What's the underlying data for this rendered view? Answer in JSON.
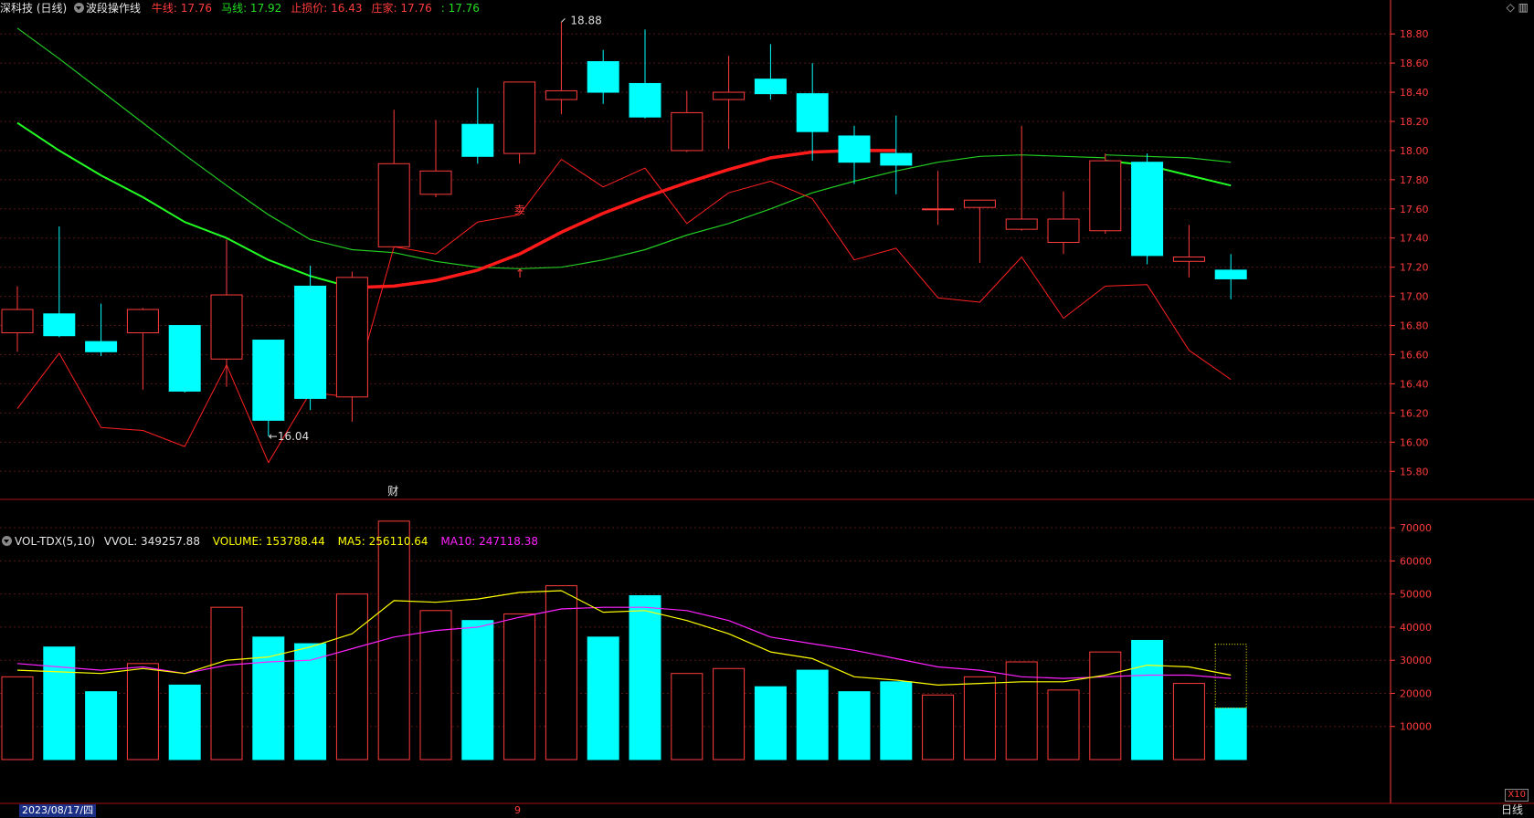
{
  "header": {
    "stock_title": "深科技 (日线)",
    "indicator_name": "波段操作线",
    "items": [
      {
        "label": "牛线:",
        "value": "17.76",
        "color": "#ff3c3c"
      },
      {
        "label": "马线:",
        "value": "17.92",
        "color": "#22dd22"
      },
      {
        "label": "止损价:",
        "value": "16.43",
        "color": "#ff3c3c"
      },
      {
        "label": "庄家:",
        "value": "17.76",
        "color": "#ff3c3c"
      },
      {
        "label": ":",
        "value": "17.76",
        "color": "#22dd22"
      }
    ],
    "corner_icons": [
      "diamond-icon",
      "book-icon"
    ]
  },
  "price_panel": {
    "axis_ticks": [
      "18.80",
      "18.60",
      "18.40",
      "18.20",
      "18.00",
      "17.80",
      "17.60",
      "17.40",
      "17.20",
      "17.00",
      "16.80",
      "16.60",
      "16.40",
      "16.20",
      "16.00",
      "15.80"
    ],
    "high_annotation": "18.88",
    "low_annotation": "16.04",
    "sell_marker": "卖",
    "buy_marker": "↑",
    "finance_marker": "财"
  },
  "volume_header": {
    "name": "VOL-TDX(5,10)",
    "vvol_label": "VVOL: 349257.88",
    "volume_label": "VOLUME: 153788.44",
    "ma5_label": "MA5: 256110.64",
    "ma10_label": "MA10: 247118.38"
  },
  "volume_panel": {
    "axis_ticks": [
      "70000",
      "60000",
      "50000",
      "40000",
      "30000",
      "20000",
      "10000"
    ],
    "scale_badge": "X10"
  },
  "footer": {
    "date": "2023/08/17/四",
    "month_mark": "9",
    "period": "日线"
  },
  "colors": {
    "up": "#ff3c3c",
    "down": "#00ffff",
    "bull_line": "#ff1a1a",
    "fast_green": "#22ff22",
    "slow_green": "#22cc22",
    "stop_line": "#ff2020",
    "ma5": "#ffff00",
    "ma10": "#ff22ff",
    "grid": "#551515",
    "axis_text": "#ff3c3c"
  },
  "chart_data": {
    "type": "candlestick",
    "candles": [
      {
        "o": 16.75,
        "h": 17.07,
        "l": 16.62,
        "c": 16.91
      },
      {
        "o": 16.88,
        "h": 17.48,
        "l": 16.72,
        "c": 16.73
      },
      {
        "o": 16.69,
        "h": 16.95,
        "l": 16.59,
        "c": 16.62
      },
      {
        "o": 16.75,
        "h": 16.92,
        "l": 16.36,
        "c": 16.91
      },
      {
        "o": 16.8,
        "h": 16.8,
        "l": 16.34,
        "c": 16.35
      },
      {
        "o": 16.57,
        "h": 17.39,
        "l": 16.38,
        "c": 17.01
      },
      {
        "o": 16.7,
        "h": 16.7,
        "l": 16.04,
        "c": 16.15
      },
      {
        "o": 17.07,
        "h": 17.21,
        "l": 16.22,
        "c": 16.3
      },
      {
        "o": 16.31,
        "h": 17.17,
        "l": 16.14,
        "c": 17.13
      },
      {
        "o": 17.34,
        "h": 18.28,
        "l": 17.34,
        "c": 17.91
      },
      {
        "o": 17.7,
        "h": 18.21,
        "l": 17.68,
        "c": 17.86
      },
      {
        "o": 18.18,
        "h": 18.43,
        "l": 17.91,
        "c": 17.96
      },
      {
        "o": 17.98,
        "h": 18.47,
        "l": 17.91,
        "c": 18.47
      },
      {
        "o": 18.35,
        "h": 18.88,
        "l": 18.25,
        "c": 18.41
      },
      {
        "o": 18.61,
        "h": 18.69,
        "l": 18.32,
        "c": 18.4
      },
      {
        "o": 18.46,
        "h": 18.83,
        "l": 18.22,
        "c": 18.23
      },
      {
        "o": 18.0,
        "h": 18.41,
        "l": 17.99,
        "c": 18.26
      },
      {
        "o": 18.35,
        "h": 18.65,
        "l": 18.01,
        "c": 18.4
      },
      {
        "o": 18.49,
        "h": 18.73,
        "l": 18.35,
        "c": 18.39
      },
      {
        "o": 18.39,
        "h": 18.6,
        "l": 17.93,
        "c": 18.13
      },
      {
        "o": 18.1,
        "h": 18.17,
        "l": 17.77,
        "c": 17.92
      },
      {
        "o": 17.98,
        "h": 18.24,
        "l": 17.7,
        "c": 17.9
      },
      {
        "o": 17.6,
        "h": 17.86,
        "l": 17.49,
        "c": 17.6
      },
      {
        "o": 17.61,
        "h": 17.66,
        "l": 17.23,
        "c": 17.66
      },
      {
        "o": 17.46,
        "h": 18.17,
        "l": 17.45,
        "c": 17.53
      },
      {
        "o": 17.37,
        "h": 17.72,
        "l": 17.29,
        "c": 17.53
      },
      {
        "o": 17.45,
        "h": 17.98,
        "l": 17.43,
        "c": 17.93
      },
      {
        "o": 17.92,
        "h": 17.98,
        "l": 17.22,
        "c": 17.28
      },
      {
        "o": 17.24,
        "h": 17.49,
        "l": 17.13,
        "c": 17.27
      },
      {
        "o": 17.18,
        "h": 17.29,
        "l": 16.98,
        "c": 17.12
      }
    ],
    "bull_line": [
      null,
      null,
      null,
      null,
      null,
      null,
      null,
      null,
      17.06,
      17.07,
      17.11,
      17.18,
      17.29,
      17.44,
      17.57,
      17.68,
      17.78,
      17.87,
      17.95,
      17.99,
      18.0,
      18.0
    ],
    "fast_green": [
      18.19,
      18.0,
      17.83,
      17.68,
      17.51,
      17.4,
      17.25,
      17.14,
      17.06
    ],
    "slow_green": [
      18.84,
      18.63,
      18.41,
      18.19,
      17.97,
      17.76,
      17.56,
      17.39,
      17.32,
      17.3,
      17.24,
      17.2,
      17.19,
      17.2,
      17.25,
      17.32,
      17.42,
      17.5,
      17.6,
      17.71,
      17.79,
      17.86,
      17.92,
      17.96,
      17.97,
      17.96,
      17.95
    ],
    "stop_line": [
      16.23,
      16.61,
      16.1,
      16.08,
      15.97,
      16.53,
      15.86,
      16.34,
      16.31,
      17.34,
      17.29,
      17.51,
      17.56,
      17.94,
      17.75,
      17.88,
      17.5,
      17.71,
      17.79,
      17.67,
      17.25,
      17.33,
      16.99,
      16.96,
      17.27,
      16.85,
      17.07,
      17.08,
      16.63,
      16.43
    ],
    "fast_green_tail": [
      null,
      null,
      null,
      null,
      null,
      null,
      null,
      null,
      null,
      null,
      null,
      null,
      null,
      null,
      null,
      null,
      null,
      null,
      null,
      null,
      null,
      null,
      null,
      null,
      null,
      null,
      17.93,
      17.9,
      17.83,
      17.76
    ],
    "slow_green_tail": [
      null,
      null,
      null,
      null,
      null,
      null,
      null,
      null,
      null,
      null,
      null,
      null,
      null,
      null,
      null,
      null,
      null,
      null,
      null,
      null,
      null,
      null,
      null,
      null,
      null,
      null,
      17.97,
      17.96,
      17.95,
      17.92
    ],
    "volume": [
      25000,
      34000,
      20500,
      29000,
      22500,
      46000,
      37000,
      35000,
      50000,
      72000,
      45000,
      42000,
      44000,
      52500,
      37000,
      49500,
      26000,
      27500,
      22000,
      27000,
      20500,
      23500,
      19500,
      25000,
      29500,
      21000,
      32500,
      36000,
      23000,
      15500
    ],
    "ma5": [
      27000,
      26500,
      26000,
      27500,
      26000,
      30000,
      31000,
      34000,
      38000,
      48000,
      47500,
      48500,
      50500,
      51000,
      44500,
      45000,
      42000,
      38000,
      32500,
      30500,
      25000,
      24000,
      22500,
      23000,
      23500,
      23500,
      25500,
      28500,
      28000,
      25500
    ],
    "ma10": [
      29000,
      28000,
      27000,
      28000,
      26000,
      28500,
      29500,
      30000,
      33500,
      37000,
      39000,
      40000,
      43000,
      45500,
      46000,
      46000,
      45000,
      42000,
      37000,
      35000,
      33000,
      30500,
      28000,
      27000,
      25000,
      24500,
      25000,
      25500,
      25500,
      24500
    ],
    "vol_ylim": [
      0,
      75000
    ],
    "price_ylim": [
      15.62,
      18.92
    ]
  }
}
